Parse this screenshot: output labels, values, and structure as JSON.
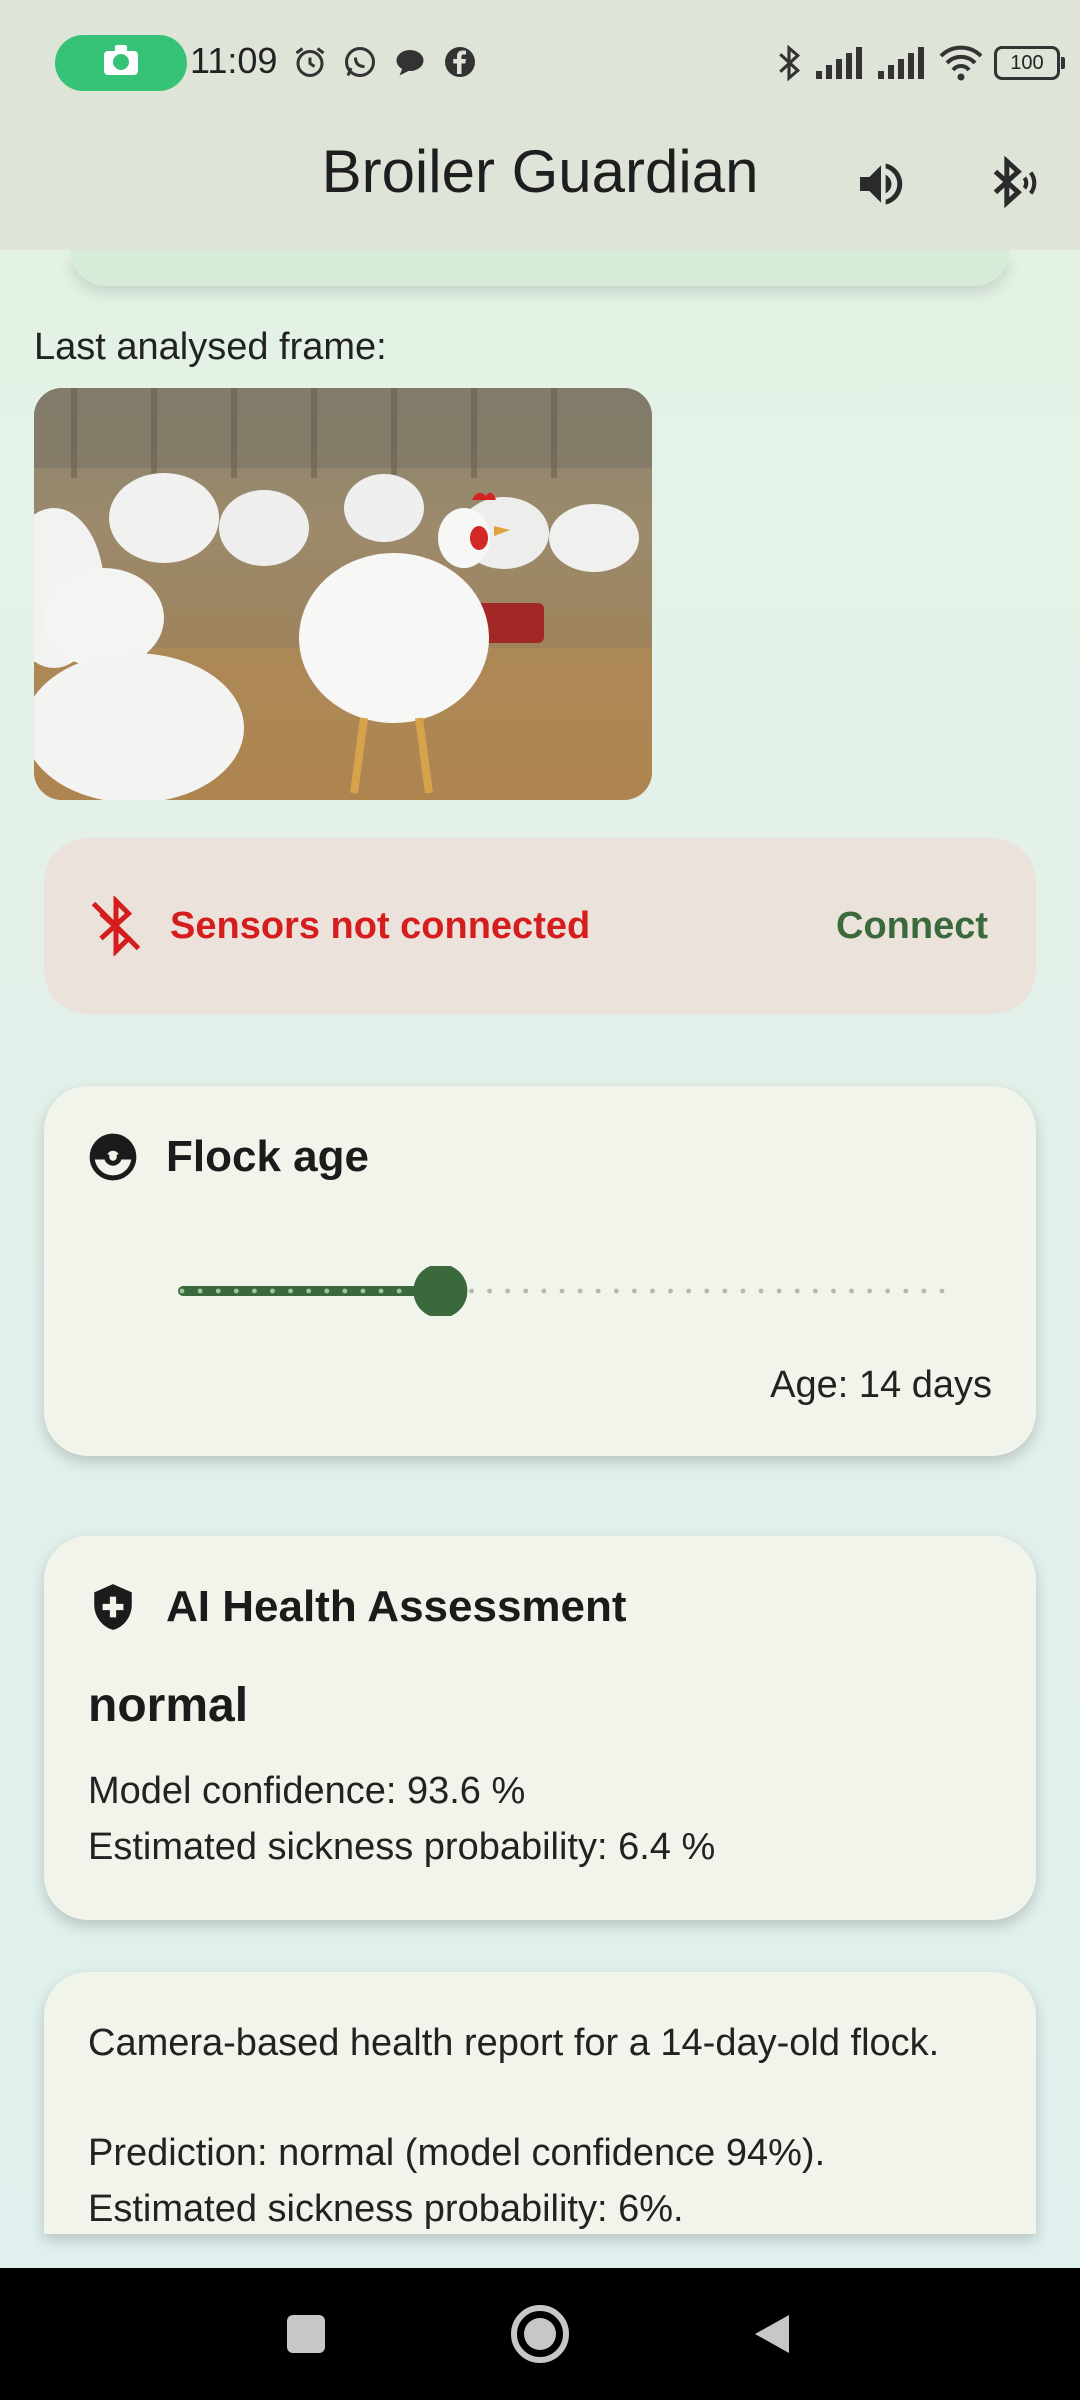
{
  "status_bar": {
    "time": "11:09",
    "left_icons": [
      "screen-recorder-icon",
      "alarm-icon",
      "whatsapp-icon",
      "chat-bubble-icon",
      "facebook-icon"
    ],
    "right_icons": [
      "bluetooth-icon",
      "signal-icon",
      "signal-icon",
      "wifi-icon"
    ],
    "battery": "100"
  },
  "app_bar": {
    "title": "Broiler Guardian",
    "actions": [
      "volume-icon",
      "bluetooth-audio-icon"
    ]
  },
  "frame": {
    "label": "Last analysed frame:",
    "image": "photo of white broiler chickens in a barn"
  },
  "sensors": {
    "status": "Sensors not connected",
    "action": "Connect",
    "status_color": "#d51d1d"
  },
  "flock_age": {
    "title": "Flock age",
    "age_text": "Age: 14 days",
    "slider_fraction": 0.34
  },
  "health": {
    "title": "AI Health Assessment",
    "status": "normal",
    "confidence_text": "Model confidence: 93.6 %",
    "sickness_text": "Estimated sickness probability: 6.4 %"
  },
  "report": {
    "line1": "Camera-based health report for a 14-day-old flock.",
    "line2": "Prediction: normal (model confidence 94%).",
    "line3": "Estimated sickness probability: 6%."
  },
  "nav": {
    "buttons": [
      "recents-button",
      "home-button",
      "back-button"
    ]
  },
  "colors": {
    "accent": "#3a6a3c",
    "app_bar": "#dfe4d9",
    "card": "#f1f4eb"
  }
}
